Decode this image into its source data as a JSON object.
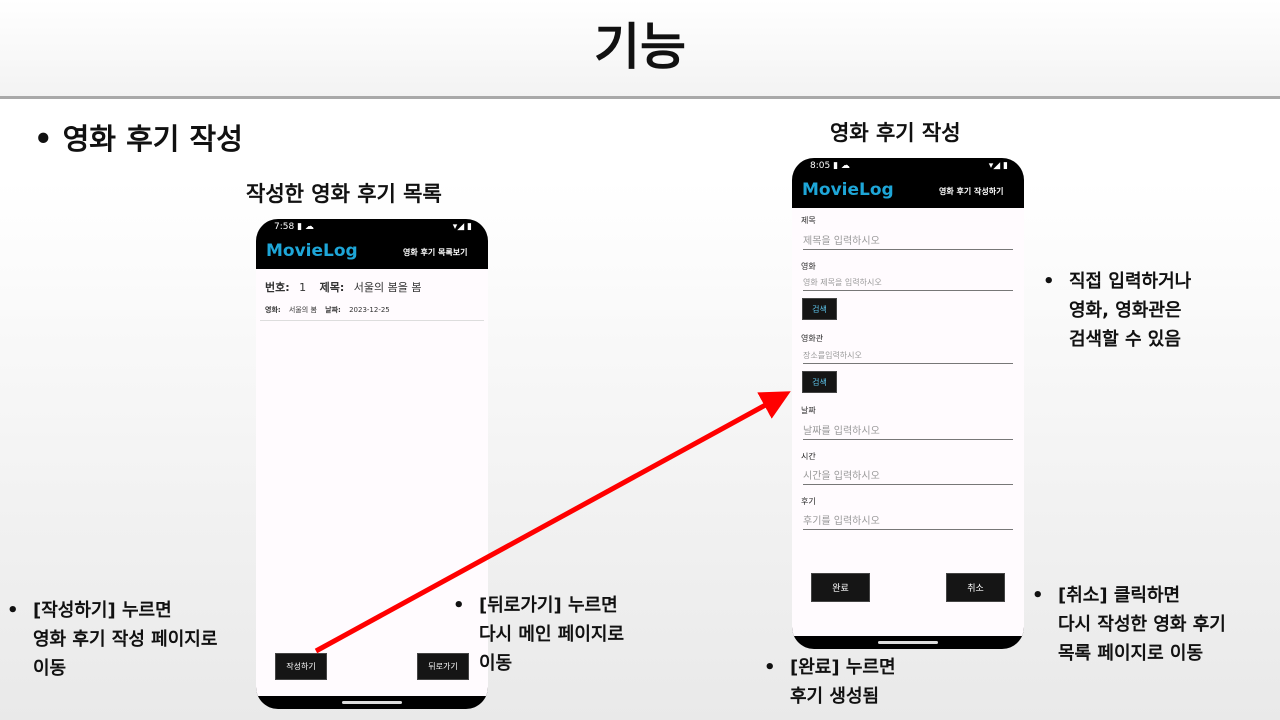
{
  "slide": {
    "title": "기능",
    "bullet": "• 영화 후기 작성",
    "caption_list": "작성한 영화 후기 목록",
    "caption_form": "영화 후기 작성"
  },
  "phone_list": {
    "status_time": "7:58",
    "status_icons_left": "▮ ☁",
    "status_icons_right": "▾◢ ▮",
    "app_title": "MovieLog",
    "action": "영화 후기 목록보기",
    "row": {
      "no_label": "번호:",
      "no_value": "1",
      "title_label": "제목:",
      "title_value": "서울의 봄을 봄",
      "movie_label": "영화:",
      "movie_value": "서울의 봄",
      "date_label": "날짜:",
      "date_value": "2023-12-25"
    },
    "write_button": "작성하기",
    "back_button": "뒤로가기"
  },
  "phone_form": {
    "status_time": "8:05",
    "status_icons_left": "▮ ☁",
    "status_icons_right": "▾◢ ▮",
    "app_title": "MovieLog",
    "action": "영화 후기 작성하기",
    "fields": {
      "title_label": "제목",
      "title_placeholder": "제목을 입력하시오",
      "movie_label": "영화",
      "movie_placeholder": "영화 제목을 입력하시오",
      "search_button_1": "검색",
      "theater_label": "영화관",
      "theater_placeholder": "장소를입력하시오",
      "search_button_2": "검색",
      "date_label": "날짜",
      "date_placeholder": "날짜를 입력하시오",
      "time_label": "시간",
      "time_placeholder": "시간을 입력하시오",
      "review_label": "후기",
      "review_placeholder": "후기를 입력하시오"
    },
    "done_button": "완료",
    "cancel_button": "취소"
  },
  "notes": {
    "write_line1": "[작성하기] 누르면",
    "write_line2": "영화 후기 작성 페이지로",
    "write_line3": "이동",
    "back_line1": "[뒤로가기] 누르면",
    "back_line2": "다시 메인 페이지로",
    "back_line3": "이동",
    "search_line1": "직접 입력하거나",
    "search_line2": "영화, 영화관은",
    "search_line3": "검색할 수 있음",
    "cancel_line1": "[취소] 클릭하면",
    "cancel_line2": "다시 작성한 영화 후기",
    "cancel_line3": "목록 페이지로 이동",
    "done_line1": "[완료] 누르면",
    "done_line2": "후기 생성됨",
    "bullet_glyph": "•"
  },
  "colors": {
    "accent": "#1ea6d8",
    "arrow": "#ff0000",
    "phone_frame": "#000000",
    "screen_bg": "#fffbfe"
  }
}
